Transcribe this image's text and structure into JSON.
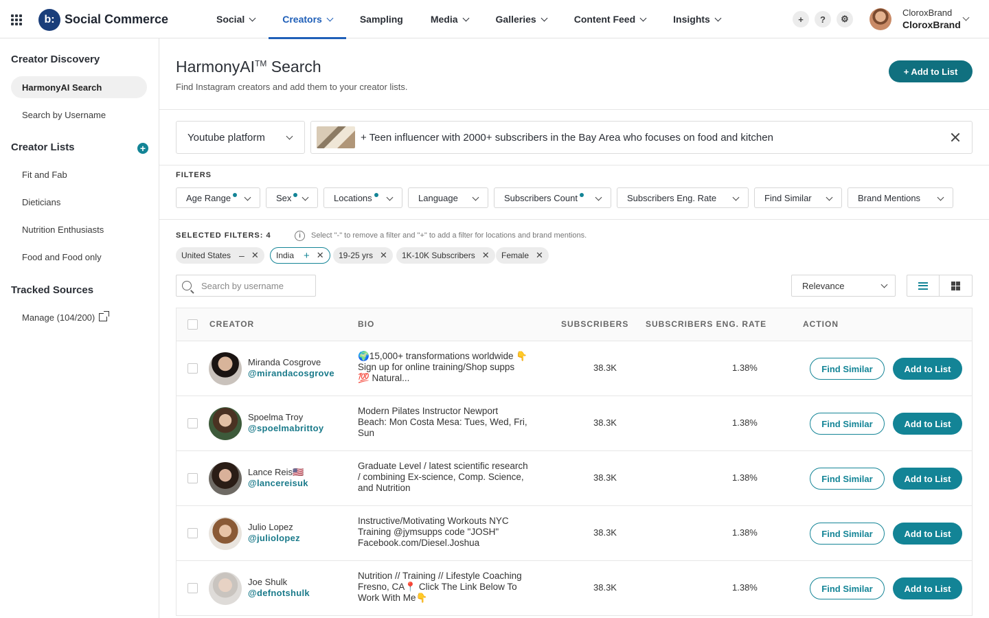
{
  "app": {
    "name": "Social Commerce",
    "logo_text": "b:"
  },
  "nav": [
    {
      "label": "Social",
      "has_dropdown": true,
      "active": false
    },
    {
      "label": "Creators",
      "has_dropdown": true,
      "active": true
    },
    {
      "label": "Sampling",
      "has_dropdown": false,
      "active": false
    },
    {
      "label": "Media",
      "has_dropdown": true,
      "active": false
    },
    {
      "label": "Galleries",
      "has_dropdown": true,
      "active": false
    },
    {
      "label": "Content Feed",
      "has_dropdown": true,
      "active": false
    },
    {
      "label": "Insights",
      "has_dropdown": true,
      "active": false
    }
  ],
  "topbar_actions": {
    "add_icon": "+",
    "help_icon": "?",
    "settings_icon": "⚙"
  },
  "user": {
    "name": "CloroxBrand",
    "brand": "CloroxBrand"
  },
  "sidebar": {
    "discovery_title": "Creator Discovery",
    "discovery_items": [
      "HarmonyAI Search",
      "Search by Username"
    ],
    "lists_title": "Creator Lists",
    "lists_add": "+",
    "lists_items": [
      "Fit and Fab",
      "Dieticians",
      "Nutrition Enthusiasts",
      "Food and Food only"
    ],
    "tracked_title": "Tracked Sources",
    "tracked_item": "Manage (104/200)"
  },
  "page": {
    "title": "HarmonyAI",
    "title_sup": "TM",
    "title_suffix": " Search",
    "subtitle": "Find Instagram creators and add them to your creator lists.",
    "add_to_list": "+ Add to List"
  },
  "search": {
    "platform": "Youtube platform",
    "query": "+ Teen influencer with 2000+ subscribers in the Bay Area who focuses on food and kitchen"
  },
  "filters": {
    "label": "FILTERS",
    "items": [
      {
        "label": "Age Range",
        "active": true
      },
      {
        "label": "Sex",
        "active": true
      },
      {
        "label": "Locations",
        "active": true
      },
      {
        "label": "Language",
        "active": false
      },
      {
        "label": "Subscribers Count",
        "active": true
      },
      {
        "label": "Subscribers Eng. Rate",
        "active": false
      },
      {
        "label": "Find Similar",
        "active": false
      },
      {
        "label": "Brand Mentions",
        "active": false
      }
    ]
  },
  "selected": {
    "label": "SELECTED FILTERS: 4",
    "hint": "Select \"-\" to remove a filter and \"+\" to add a filter for locations and brand mentions.",
    "chips": [
      {
        "label": "United States",
        "mode": "minus"
      },
      {
        "label": "India",
        "mode": "plus"
      },
      {
        "label": "19-25 yrs",
        "mode": "none"
      },
      {
        "label": "1K-10K Subscribers",
        "mode": "none"
      },
      {
        "label": "Female",
        "mode": "none"
      }
    ]
  },
  "toolbar": {
    "search_placeholder": "Search by username",
    "sort": "Relevance"
  },
  "table": {
    "headers": {
      "creator": "CREATOR",
      "bio": "BIO",
      "subscribers": "SUBSCRIBERS",
      "eng_rate": "SUBSCRIBERS ENG. RATE",
      "action": "ACTION"
    },
    "find_similar": "Find Similar",
    "add_to_list": "Add to List",
    "rows": [
      {
        "name": "Miranda Cosgrove",
        "handle": "@mirandacosgrove",
        "bio": "🌍15,000+ transformations worldwide 👇 Sign up for online training/Shop supps 💯 Natural...",
        "subscribers": "38.3K",
        "eng_rate": "1.38%"
      },
      {
        "name": "Spoelma Troy",
        "handle": "@spoelmabrittoy",
        "bio": "Modern Pilates Instructor Newport Beach: Mon Costa Mesa: Tues, Wed, Fri, Sun",
        "subscribers": "38.3K",
        "eng_rate": "1.38%"
      },
      {
        "name": "Lance Reis🇺🇸",
        "handle": "@lancereisuk",
        "bio": "Graduate Level / latest scientific research / combining Ex-science, Comp. Science, and Nutrition",
        "subscribers": "38.3K",
        "eng_rate": "1.38%"
      },
      {
        "name": "Julio Lopez",
        "handle": "@juliolopez",
        "bio": "Instructive/Motivating Workouts NYC Training @jymsupps code \"JOSH\" Facebook.com/Diesel.Joshua",
        "subscribers": "38.3K",
        "eng_rate": "1.38%"
      },
      {
        "name": "Joe Shulk",
        "handle": "@defnotshulk",
        "bio": "Nutrition // Training // Lifestyle Coaching Fresno, CA📍 Click The Link Below To Work With Me👇",
        "subscribers": "38.3K",
        "eng_rate": "1.38%"
      }
    ]
  },
  "colors": {
    "accent": "#138496",
    "primary_dark": "#10707f",
    "nav_active": "#1f5fb8",
    "logo": "#1a3e7a"
  }
}
